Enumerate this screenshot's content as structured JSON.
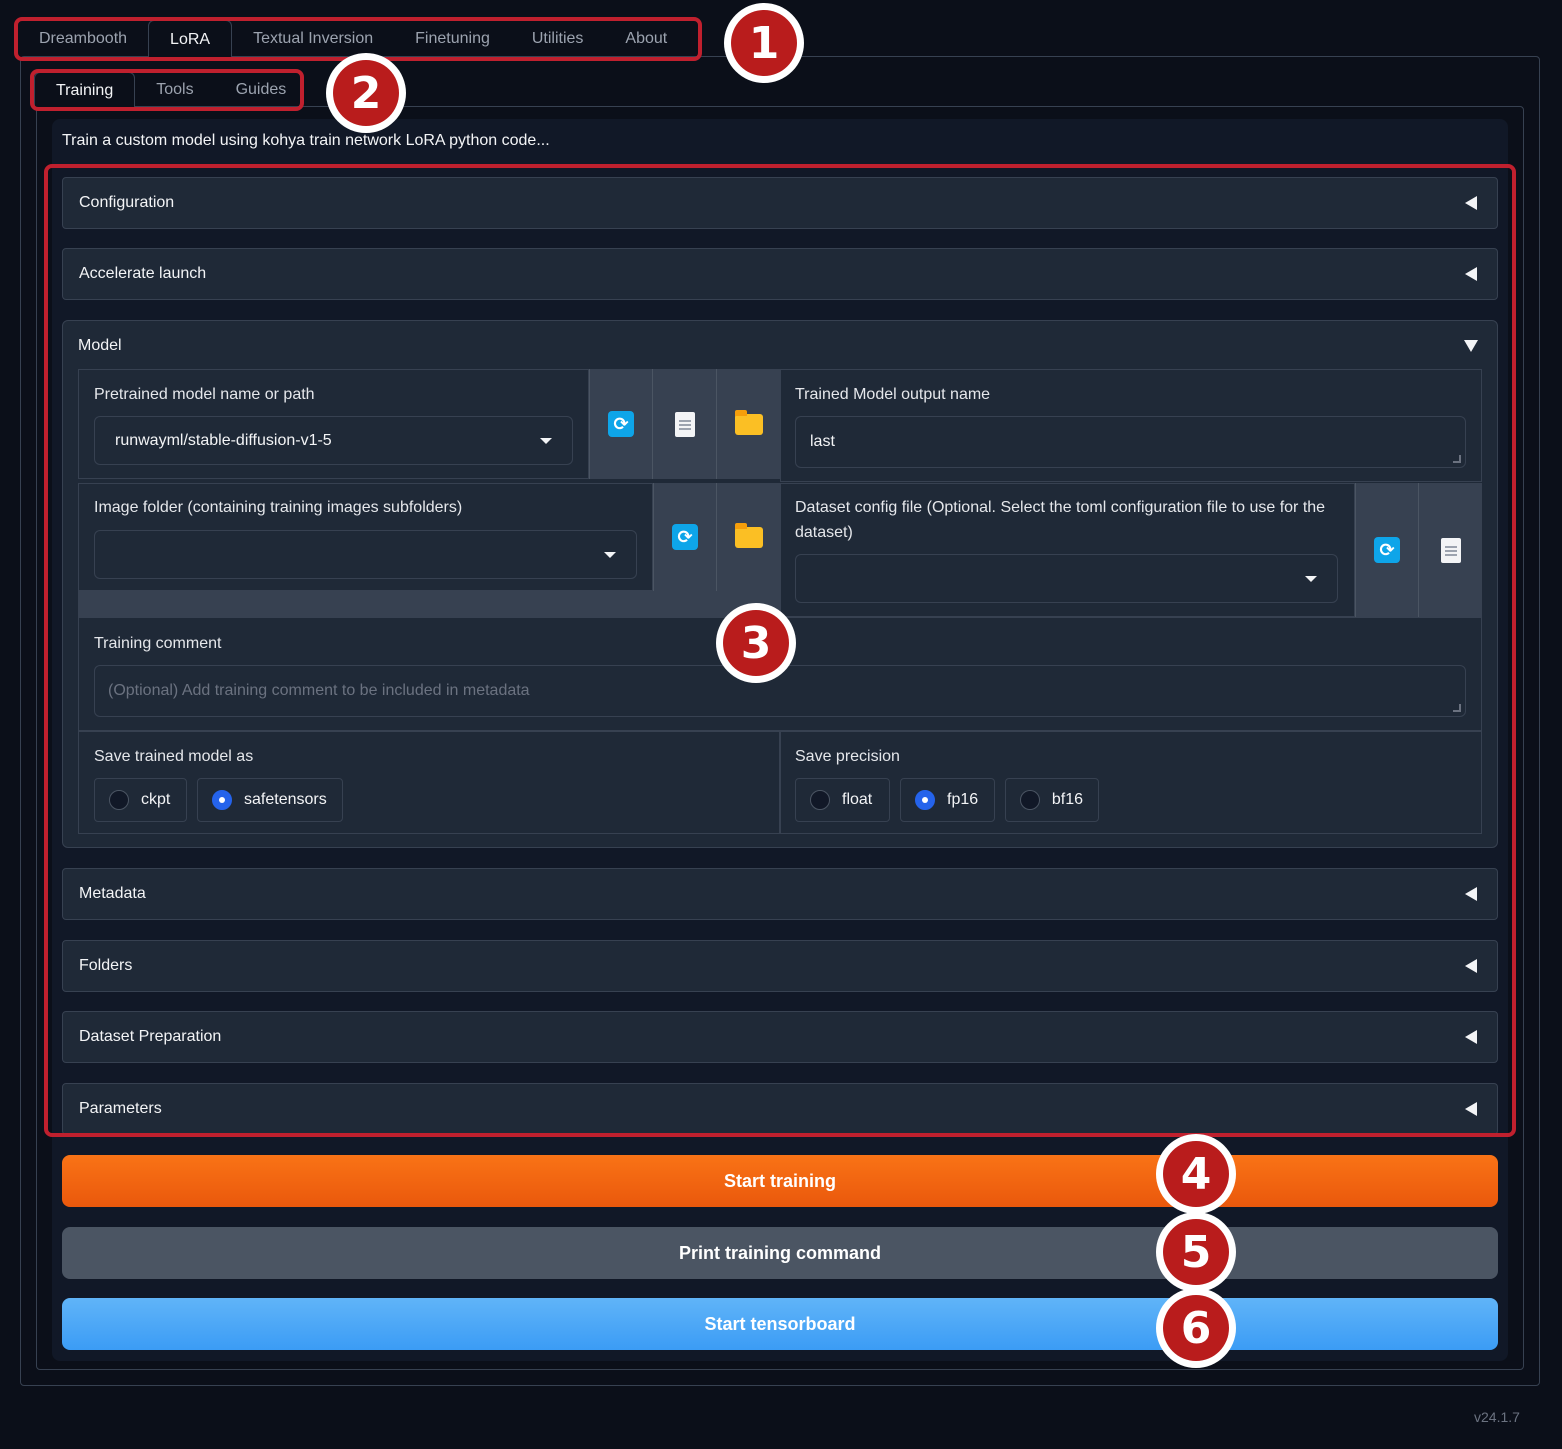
{
  "top_tabs": [
    "Dreambooth",
    "LoRA",
    "Textual Inversion",
    "Finetuning",
    "Utilities",
    "About"
  ],
  "top_tab_selected": "LoRA",
  "sub_tabs": [
    "Training",
    "Tools",
    "Guides"
  ],
  "sub_tab_selected": "Training",
  "description": "Train a custom model using kohya train network LoRA python code...",
  "accordions": {
    "configuration": "Configuration",
    "accelerate": "Accelerate launch",
    "model": "Model",
    "metadata": "Metadata",
    "folders": "Folders",
    "dataset_prep": "Dataset Preparation",
    "parameters": "Parameters"
  },
  "model": {
    "pretrained_label": "Pretrained model name or path",
    "pretrained_value": "runwayml/stable-diffusion-v1-5",
    "output_name_label": "Trained Model output name",
    "output_name_value": "last",
    "image_folder_label": "Image folder (containing training images subfolders)",
    "image_folder_value": "",
    "dataset_config_label": "Dataset config file (Optional. Select the toml configuration file to use for the dataset)",
    "dataset_config_value": "",
    "training_comment_label": "Training comment",
    "training_comment_placeholder": "(Optional) Add training comment to be included in metadata",
    "save_as_label": "Save trained model as",
    "save_as_options": [
      "ckpt",
      "safetensors"
    ],
    "save_as_selected": "safetensors",
    "precision_label": "Save precision",
    "precision_options": [
      "float",
      "fp16",
      "bf16"
    ],
    "precision_selected": "fp16"
  },
  "buttons": {
    "start_training": "Start training",
    "print_command": "Print training command",
    "start_tensorboard": "Start tensorboard"
  },
  "markers": [
    "1",
    "2",
    "3",
    "4",
    "5",
    "6"
  ],
  "version": "v24.1.7",
  "colors": {
    "background": "#0b0f19",
    "annotation_red": "#c0202e",
    "primary_orange": "#f97316",
    "secondary_gray": "#4b5563",
    "tensorboard_blue": "#3b9cf5",
    "radio_selected": "#2563eb"
  },
  "icons": [
    "refresh-icon",
    "document-icon",
    "folder-icon",
    "triangle-left-icon",
    "triangle-down-icon",
    "chevron-down-icon"
  ]
}
